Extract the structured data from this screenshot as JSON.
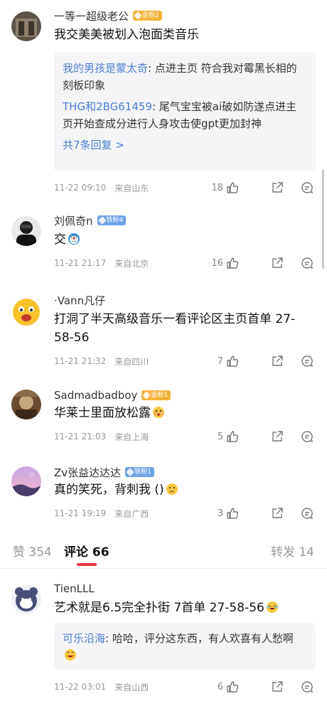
{
  "comments": [
    {
      "username": "一等一超级老公",
      "badge": "金粉2",
      "badge_color": "#f3b33a",
      "text": "我交美美被划入泡面类音乐",
      "replies": [
        {
          "name": "我的男孩是蒙太奇",
          "text": ": 点进主页 符合我对霉黑长相的刻板印象"
        },
        {
          "name": "THG和2BG61459",
          "text": ": 尾气宝宝被ai破如防遂点进主页开始查成分进行人身攻击使gpt更加封神"
        }
      ],
      "more_replies": "共7条回复 >",
      "date": "11-22 09:10",
      "location": "来自山东",
      "likes": "18"
    },
    {
      "username": "刘佩奇n",
      "badge": "铁粉4",
      "badge_color": "#6fa3e6",
      "text": "交",
      "emoji": "doraemon-emoji",
      "date": "11-21 21:17",
      "location": "来自北京",
      "likes": "16"
    },
    {
      "username": "·Vann凡仔",
      "text": "打洞了半天高级音乐一看评论区主页首单 27-58-56",
      "date": "11-21 21:32",
      "location": "来自四川",
      "likes": "7"
    },
    {
      "username": "Sadmadbadboy",
      "badge": "金粉1",
      "badge_color": "#f3b33a",
      "text": "华莱士里面放松露",
      "emoji": "surprised-emoji",
      "date": "11-21 21:03",
      "location": "来自上海",
      "likes": "5"
    },
    {
      "username": "Zv张益达达达",
      "badge": "铁粉1",
      "badge_color": "#6fa3e6",
      "text": "真的笑死，背刺我 ()",
      "emoji": "thinking-emoji",
      "date": "11-21 19:19",
      "location": "来自广西",
      "likes": "3"
    }
  ],
  "tabs": {
    "likes": "赞 354",
    "comments": "评论 66",
    "reposts": "转发 14"
  },
  "bottom_comment": {
    "username": "TienLLL",
    "text": "艺术就是6.5完全扑街 7首单 27-58-56",
    "emoji": "laughing-emoji",
    "reply_name": "可乐沿海",
    "reply_text": ": 哈哈，评分这东西，有人欢喜有人愁啊",
    "reply_emoji": "grin-emoji",
    "date": "11-22 03:01",
    "location": "来自山西",
    "likes": "6"
  },
  "colors": {
    "link_blue": "#4a7fd1",
    "accent_red": "#e8343e",
    "reply_bg": "#f5f5f7"
  }
}
